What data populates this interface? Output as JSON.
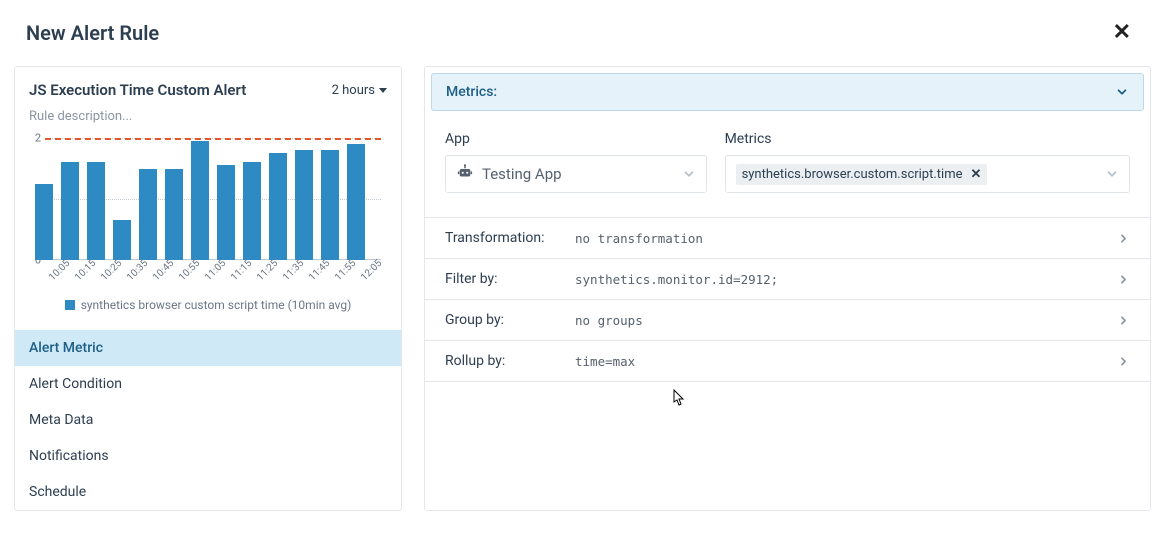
{
  "header": {
    "title": "New Alert Rule"
  },
  "left": {
    "alert_title": "JS Execution Time Custom Alert",
    "time_range": "2 hours",
    "rule_description_placeholder": "Rule description...",
    "legend": "synthetics browser custom script time (10min avg)",
    "nav": [
      {
        "label": "Alert Metric",
        "active": true
      },
      {
        "label": "Alert Condition",
        "active": false
      },
      {
        "label": "Meta Data",
        "active": false
      },
      {
        "label": "Notifications",
        "active": false
      },
      {
        "label": "Schedule",
        "active": false
      }
    ]
  },
  "right": {
    "section_title": "Metrics:",
    "app_label": "App",
    "app_value": "Testing App",
    "metrics_label": "Metrics",
    "metric_chip": "synthetics.browser.custom.script.time",
    "rows": {
      "transformation": {
        "label": "Transformation:",
        "value": "no transformation"
      },
      "filter": {
        "label": "Filter by:",
        "value": "synthetics.monitor.id=2912;"
      },
      "group": {
        "label": "Group by:",
        "value": "no groups"
      },
      "rollup": {
        "label": "Rollup by:",
        "value": "time=max"
      }
    }
  },
  "chart_data": {
    "type": "bar",
    "categories": [
      "10:05",
      "10:15",
      "10:25",
      "10:35",
      "10:45",
      "10:55",
      "11:05",
      "11:15",
      "11:25",
      "11:35",
      "11:45",
      "11:55",
      "12:05"
    ],
    "values": [
      1.25,
      1.6,
      1.6,
      0.65,
      1.5,
      1.5,
      1.95,
      1.55,
      1.6,
      1.75,
      1.8,
      1.8,
      1.9
    ],
    "yticks": [
      0,
      1,
      2
    ],
    "ylim": [
      0,
      2
    ],
    "threshold": 2,
    "title": "",
    "xlabel": "",
    "ylabel": "",
    "legend": "synthetics browser custom script time (10min avg)"
  },
  "colors": {
    "bar": "#2d8ac3",
    "threshold": "#e1592a",
    "panel_highlight": "#cfe9f6"
  }
}
